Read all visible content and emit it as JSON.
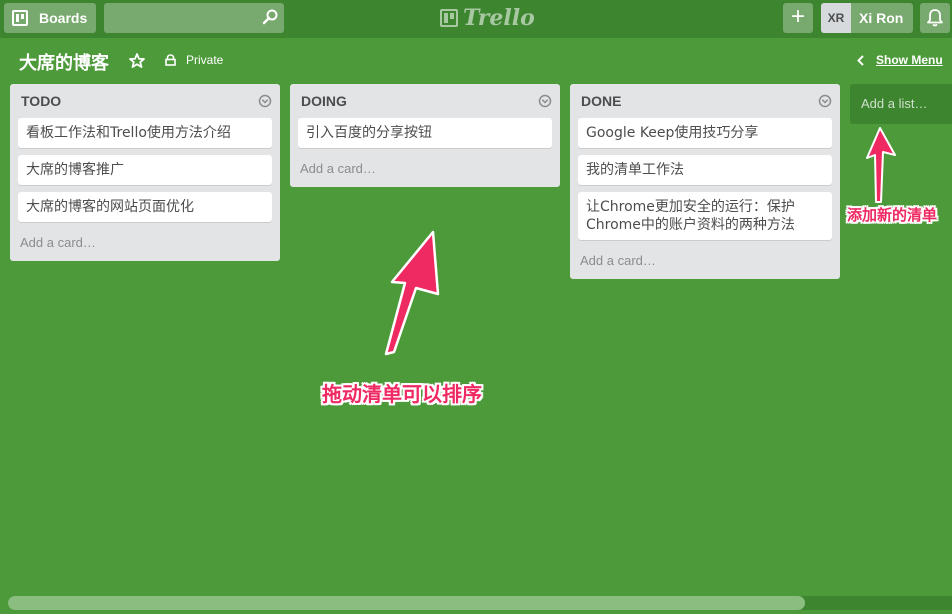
{
  "header": {
    "boards_label": "Boards",
    "search_value": "",
    "logo_text": "Trello",
    "add_symbol": "+",
    "user_initials": "XR",
    "user_name": "Xi Ron"
  },
  "board": {
    "title": "大席的博客",
    "visibility": "Private",
    "show_menu_label": "Show Menu"
  },
  "lists": [
    {
      "title": "TODO",
      "cards": [
        "看板工作法和Trello使用方法介绍",
        "大席的博客推广",
        "大席的博客的网站页面优化"
      ],
      "add_card_label": "Add a card…"
    },
    {
      "title": "DOING",
      "cards": [
        "引入百度的分享按钮"
      ],
      "add_card_label": "Add a card…"
    },
    {
      "title": "DONE",
      "cards": [
        "Google Keep使用技巧分享",
        "我的清单工作法",
        "让Chrome更加安全的运行：保护Chrome中的账户资料的两种方法"
      ],
      "add_card_label": "Add a card…"
    }
  ],
  "add_list_label": "Add a list…",
  "annotations": {
    "add_list_note": "添加新的清单",
    "drag_note": "拖动清单可以排序"
  },
  "colors": {
    "board_bg": "#4d9a3a",
    "header_bg": "#3e8530",
    "annotation": "#ef2a63"
  },
  "icons": [
    "boards-icon",
    "search-icon",
    "trello-logo-icon",
    "plus-icon",
    "bell-icon",
    "star-icon",
    "lock-icon",
    "chevron-left-icon",
    "list-menu-icon"
  ]
}
